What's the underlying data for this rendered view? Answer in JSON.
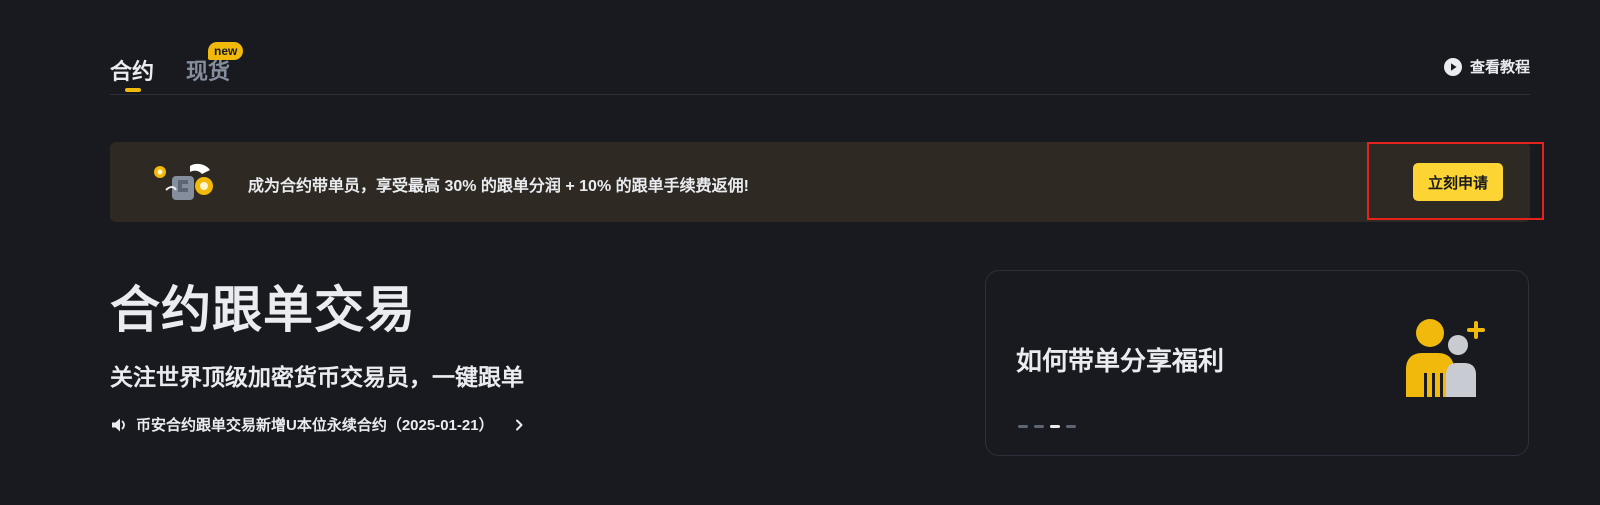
{
  "tabs": {
    "items": [
      {
        "label": "合约",
        "active": true
      },
      {
        "label": "现货",
        "active": false
      }
    ],
    "new_badge": "new",
    "tutorial_label": "查看教程"
  },
  "banner": {
    "text": "成为合约带单员，享受最高 30% 的跟单分润 + 10% 的跟单手续费返佣!",
    "apply_label": "立刻申请"
  },
  "hero": {
    "title": "合约跟单交易",
    "subtitle": "关注世界顶级加密货币交易员，一键跟单",
    "announcement": "币安合约跟单交易新增U本位永续合约（2025-01-21）"
  },
  "card": {
    "title": "如何带单分享福利",
    "carousel": {
      "total": 4,
      "active_index": 2
    }
  },
  "colors": {
    "background": "#181a20",
    "accent": "#fcd535",
    "banner_bg": "#2e2923",
    "highlight": "#e5231c"
  },
  "icons": [
    "play-icon",
    "speaker-icon",
    "chevron-right-icon",
    "trader-coin-illustration",
    "people-add-illustration"
  ]
}
